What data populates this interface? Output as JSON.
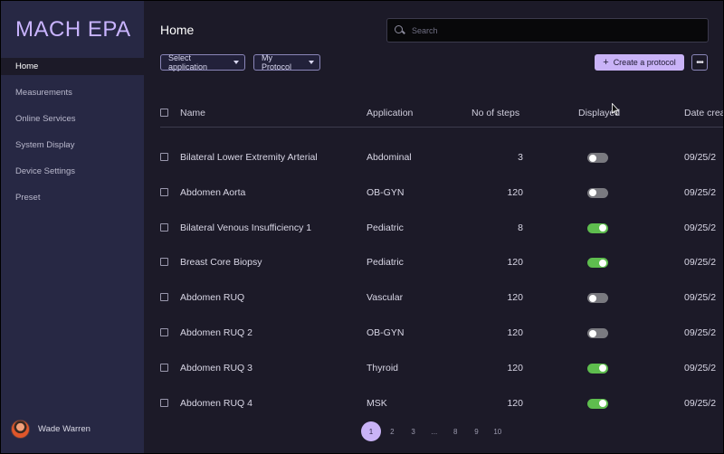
{
  "app": {
    "logo": "MACH EPA"
  },
  "sidebar": {
    "items": [
      {
        "label": "Home",
        "active": true
      },
      {
        "label": "Measurements",
        "active": false
      },
      {
        "label": "Online Services",
        "active": false
      },
      {
        "label": "System Display",
        "active": false
      },
      {
        "label": "Device Settings",
        "active": false
      },
      {
        "label": "Preset",
        "active": false
      }
    ],
    "user": {
      "name": "Wade Warren"
    }
  },
  "header": {
    "title": "Home",
    "search_placeholder": "Search"
  },
  "toolbar": {
    "select_application": "Select application",
    "my_protocol": "My Protocol",
    "create_label": "Create a protocol",
    "more_label": "•••"
  },
  "table": {
    "columns": [
      "Name",
      "Application",
      "No of steps",
      "Displayed",
      "Date crea"
    ],
    "rows": [
      {
        "name": "Bilateral Lower Extremity Arterial",
        "application": "Abdominal",
        "steps": "3",
        "displayed": false,
        "date": "09/25/2"
      },
      {
        "name": "Abdomen Aorta",
        "application": "OB-GYN",
        "steps": "120",
        "displayed": false,
        "date": "09/25/2"
      },
      {
        "name": "Bilateral Venous Insufficiency 1",
        "application": "Pediatric",
        "steps": "8",
        "displayed": true,
        "date": "09/25/2"
      },
      {
        "name": "Breast Core Biopsy",
        "application": "Pediatric",
        "steps": "120",
        "displayed": true,
        "date": "09/25/2"
      },
      {
        "name": "Abdomen RUQ",
        "application": "Vascular",
        "steps": "120",
        "displayed": false,
        "date": "09/25/2"
      },
      {
        "name": "Abdomen RUQ 2",
        "application": "OB-GYN",
        "steps": "120",
        "displayed": false,
        "date": "09/25/2"
      },
      {
        "name": "Abdomen RUQ 3",
        "application": "Thyroid",
        "steps": "120",
        "displayed": true,
        "date": "09/25/2"
      },
      {
        "name": "Abdomen RUQ 4",
        "application": "MSK",
        "steps": "120",
        "displayed": true,
        "date": "09/25/2"
      }
    ]
  },
  "pagination": {
    "pages": [
      "1",
      "2",
      "3",
      "...",
      "8",
      "9",
      "10"
    ],
    "current": "1"
  },
  "colors": {
    "accent": "#c9b3f7",
    "sidebar_bg": "#272844",
    "main_bg": "#1c1a28",
    "toggle_on": "#5ebd4e",
    "toggle_off": "#7a7a80"
  }
}
